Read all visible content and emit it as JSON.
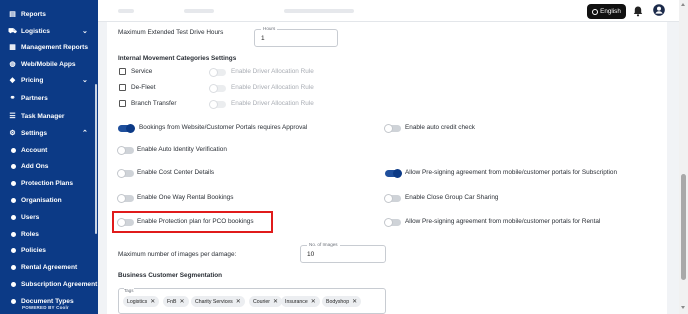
{
  "sidebar": {
    "items": [
      {
        "label": "Reports",
        "icon": "reports-icon",
        "glyph": "▤",
        "chevron": ""
      },
      {
        "label": "Logistics",
        "icon": "truck-icon",
        "glyph": "⛟",
        "chevron": "⌄"
      },
      {
        "label": "Management Reports",
        "icon": "chart-icon",
        "glyph": "▦",
        "chevron": ""
      },
      {
        "label": "Web/Mobile Apps",
        "icon": "globe-icon",
        "glyph": "◍",
        "chevron": ""
      },
      {
        "label": "Pricing",
        "icon": "tag-icon",
        "glyph": "◆",
        "chevron": "⌄"
      },
      {
        "label": "Partners",
        "icon": "handshake-icon",
        "glyph": "⚭",
        "chevron": ""
      },
      {
        "label": "Task Manager",
        "icon": "task-icon",
        "glyph": "☰",
        "chevron": ""
      },
      {
        "label": "Settings",
        "icon": "gear-icon",
        "glyph": "⚙",
        "chevron": "⌃"
      }
    ],
    "subitems": [
      "Account",
      "Add Ons",
      "Protection Plans",
      "Organisation",
      "Users",
      "Roles",
      "Policies",
      "Rental Agreement",
      "Subscription Agreement",
      "Document Types"
    ],
    "powered_by": "POWERED BY Coolr"
  },
  "topbar": {
    "language": "English"
  },
  "form": {
    "max_extended_label": "Maximum Extended Test Drive Hours",
    "hours_label": "Hours",
    "hours_value": "1",
    "internal_heading": "Internal Movement Categories Settings",
    "internal_rows": [
      {
        "label": "Service",
        "toggle_label": "Enable Driver Allocation Rule"
      },
      {
        "label": "De-Fleet",
        "toggle_label": "Enable Driver Allocation Rule"
      },
      {
        "label": "Branch Transfer",
        "toggle_label": "Enable Driver Allocation Rule"
      }
    ],
    "toggles_left": [
      {
        "label": "Bookings from Website/Customer Portals requires Approval",
        "on": true
      },
      {
        "label": "Enable Auto Identity Verification",
        "on": false
      },
      {
        "label": "Enable Cost Center Details",
        "on": false
      },
      {
        "label": "Enable One Way Rental Bookings",
        "on": false
      },
      {
        "label": "Enable Protection plan for PCO bookings",
        "on": false
      }
    ],
    "toggles_right": [
      {
        "label": "Enable auto credit check",
        "on": false
      },
      {
        "label": "Allow Pre-signing agreement from mobile/customer portals for Subscription",
        "on": true
      },
      {
        "label": "Enable Close Group Car Sharing",
        "on": false
      },
      {
        "label": "Allow Pre-signing agreement from mobile/customer portals for Rental",
        "on": false
      }
    ],
    "max_images_label": "Maximum number of images per damage:",
    "images_field_label": "No. of Images",
    "images_value": "10",
    "segmentation_heading": "Business Customer Segmentation",
    "tags_label": "Tags",
    "tags": [
      "Logistics",
      "FnB",
      "Charity Services",
      "Courier",
      "Insurance",
      "Bodyshop"
    ]
  },
  "colors": {
    "sidebar_bg": "#0c3a86",
    "toggle_on": "#1f4f9c",
    "highlight": "#e01b1b"
  }
}
